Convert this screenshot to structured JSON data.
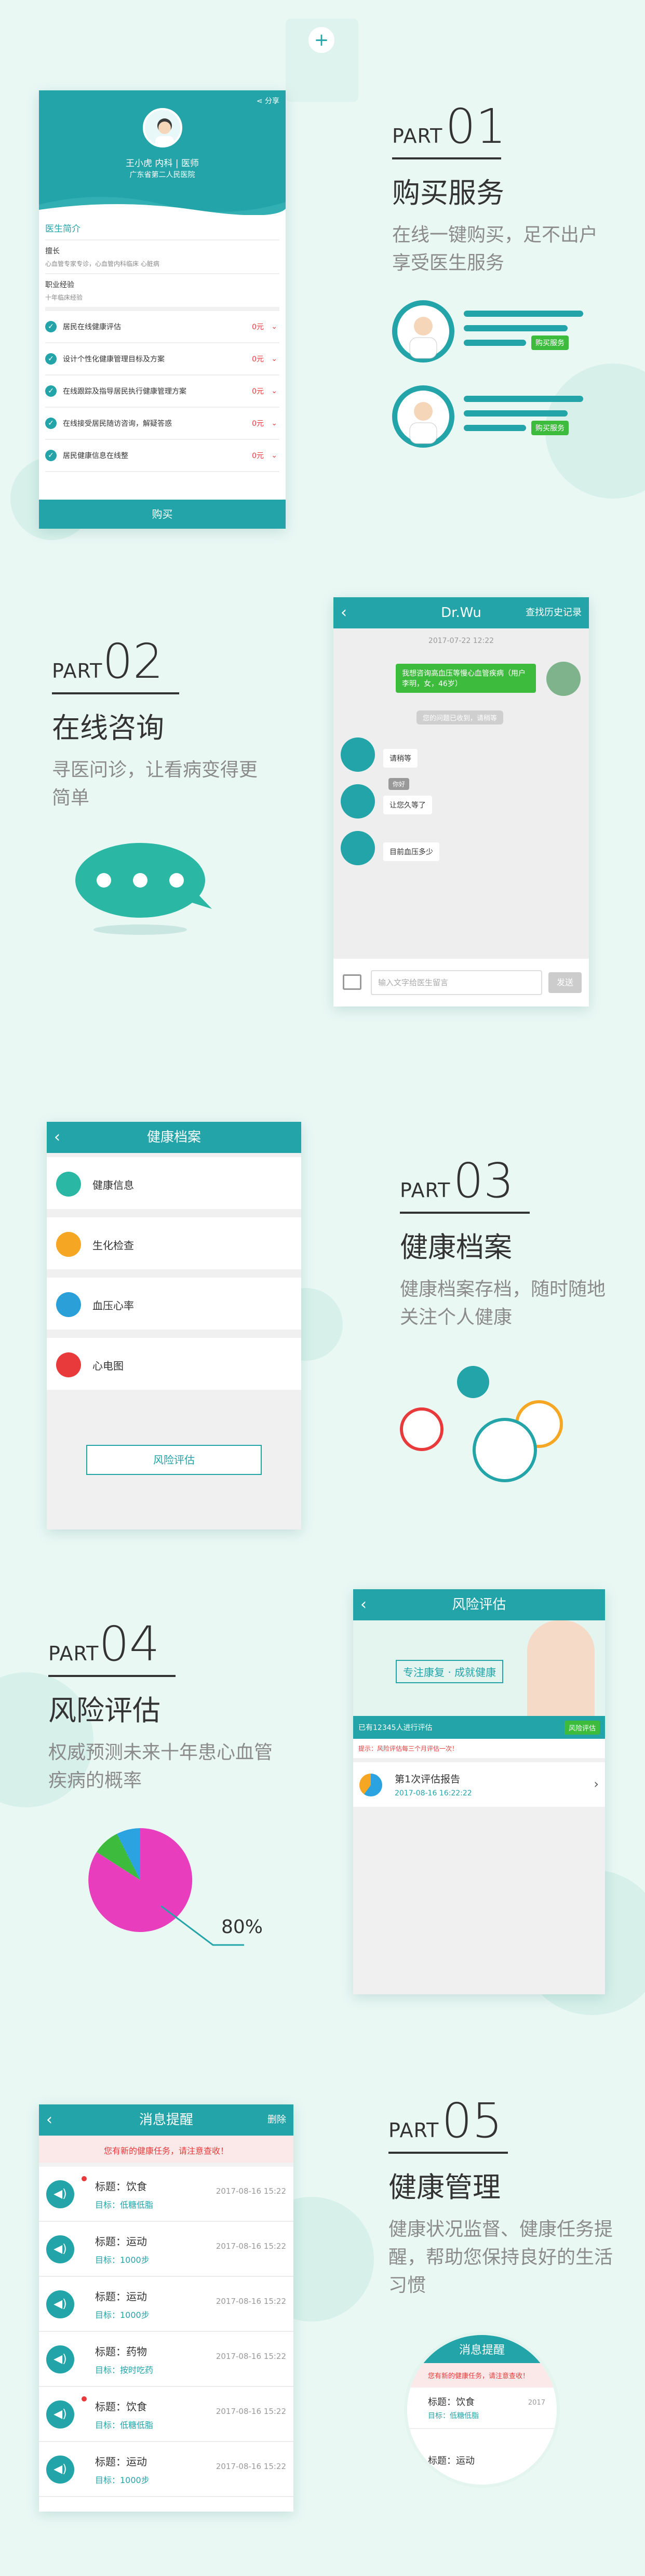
{
  "top_nav_icon": "plus-icon",
  "s1": {
    "share": "分享",
    "doctor_name": "王小虎 内科 | 医师",
    "hospital": "广东省第二人民医院",
    "intro_title": "医生简介",
    "specialty_label": "擅长",
    "specialty_text": "心血管专家专诊，心血管内科临床 心脏病",
    "experience_label": "职业经验",
    "experience_text": "十年临床经验",
    "services": [
      {
        "name": "居民在线健康评估",
        "price": "0元"
      },
      {
        "name": "设计个性化健康管理目标及方案",
        "price": "0元"
      },
      {
        "name": "在线跟踪及指导居民执行健康管理方案",
        "price": "0元"
      },
      {
        "name": "在线接受居民随访咨询，解疑答惑",
        "price": "0元"
      },
      {
        "name": "居民健康信息在线整",
        "price": "0元"
      }
    ],
    "buy_button": "购买",
    "part_label": "PART",
    "part_num": "01",
    "title": "购买服务",
    "desc": "在线一键购买，足不出户享受医生服务",
    "buy_tag": "购买服务"
  },
  "s2": {
    "header_title": "Dr.Wu",
    "header_right": "查找历史记录",
    "date": "2017-07-22  12:22",
    "patient_msg": "我想咨询高血压等慢心血管疾病（用户李明，女，46岁）",
    "system_msg": "您的问题已收到，请稍等",
    "replies": [
      "请稍等",
      "你好",
      "让您久等了",
      "目前血压多少"
    ],
    "input_placeholder": "输入文字给医生留言",
    "send_button": "发送",
    "part_label": "PART",
    "part_num": "02",
    "title": "在线咨询",
    "desc": "寻医问诊，让看病变得更简单"
  },
  "s3": {
    "header_title": "健康档案",
    "items": [
      "健康信息",
      "生化检查",
      "血压心率",
      "心电图"
    ],
    "risk_button": "风险评估",
    "part_label": "PART",
    "part_num": "03",
    "title": "健康档案",
    "desc": "健康档案存档，随时随地关注个人健康"
  },
  "s4": {
    "header_title": "风险评估",
    "banner_text": "专注康复 · 成就健康",
    "count_text": "已有12345人进行评估",
    "eval_button": "风险评估",
    "notice": "提示：风险评估每三个月评估一次！",
    "report_title": "第1次评估报告",
    "report_date": "2017-08-16  16:22:22",
    "part_label": "PART",
    "part_num": "04",
    "title": "风险评估",
    "desc": "权威预测未来十年患心血管疾病的概率",
    "pie_label": "80%"
  },
  "s5": {
    "header_title": "消息提醒",
    "header_right": "删除",
    "alert": "您有新的健康任务，请注意查收！",
    "messages": [
      {
        "title": "标题：饮食",
        "goal": "目标：低糖低脂",
        "date": "2017-08-16 15:22",
        "unread": true
      },
      {
        "title": "标题：运动",
        "goal": "目标：1000步",
        "date": "2017-08-16 15:22",
        "unread": false
      },
      {
        "title": "标题：运动",
        "goal": "目标：1000步",
        "date": "2017-08-16 15:22",
        "unread": false
      },
      {
        "title": "标题：药物",
        "goal": "目标：按时吃药",
        "date": "2017-08-16 15:22",
        "unread": false
      },
      {
        "title": "标题：饮食",
        "goal": "目标：低糖低脂",
        "date": "2017-08-16 15:22",
        "unread": true
      },
      {
        "title": "标题：运动",
        "goal": "目标：1000步",
        "date": "2017-08-16 15:22",
        "unread": false
      }
    ],
    "part_label": "PART",
    "part_num": "05",
    "title": "健康管理",
    "desc": "健康状况监督、健康任务提醒，帮助您保持良好的生活习惯",
    "zoom_title": "消息提醒",
    "zoom_alert": "您有新的健康任务，请注意查收！",
    "zoom_msg_title": "标题：饮食",
    "zoom_msg_goal": "目标：低糖低脂",
    "zoom_msg_date": "2017",
    "zoom_msg2_title": "标题：运动"
  },
  "colors": {
    "teal": "#22a4a8",
    "red": "#e83a3a",
    "green": "#3dbb3d",
    "orange": "#f5a623"
  }
}
